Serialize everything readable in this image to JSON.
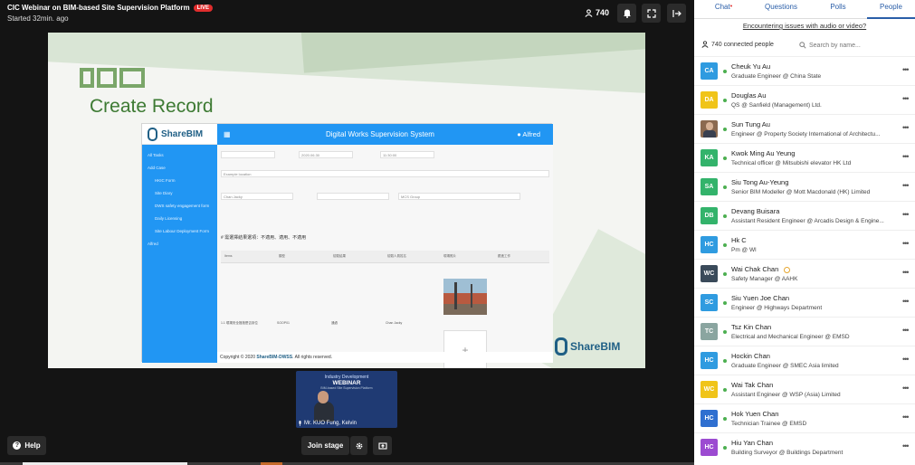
{
  "header": {
    "title": "CIC Webinar on BIM-based Site Supervision Platform",
    "live_label": "LIVE",
    "started": "Started 32min. ago",
    "viewer_count": "740"
  },
  "slide": {
    "title": "Create Record",
    "app": {
      "brand": "ShareBIM",
      "window_title": "Digital Works Supervision System",
      "user": "Alfred",
      "sidebar": [
        "All Tasks",
        "Add Case",
        "HKIC Form",
        "Site Diary",
        "DWS safety engagement form",
        "Daily Licensing",
        "Site Labour Deployment Form",
        "Alfred"
      ],
      "fields": {
        "date_value": "2020.06.30",
        "time_value": "11:30:00",
        "location_value": "Example location",
        "inspector_value": "Chan Jacky",
        "contractor_value": "MCS Group"
      },
      "note": "# 需選擇結果選項：不適用、適用、不適用",
      "grid_headers": [
        "Items",
        "類型",
        "檢驗結果",
        "檢驗人員姓名",
        "現場照片",
        "跟進工作"
      ],
      "cell_items": "1.1 現場安全措施是否到位",
      "cell_type": "SOOP01",
      "cell_result": "通過",
      "cell_person": "Chan Jacky",
      "add_symbol": "+",
      "footer_prefix": "Copyright © 2020 ",
      "footer_brand": "ShareBIM-DWSS",
      "footer_suffix": ". All rights reserved."
    },
    "brand_bottom": "ShareBIM"
  },
  "speaker": {
    "banner_top": "Industry Development",
    "banner_main": "WEBINAR",
    "banner_sub": "BIM-based Site Supervision Platform",
    "name": "Mr. KUO Fung, Kelvin"
  },
  "controls": {
    "help_label": "Help",
    "join_label": "Join stage"
  },
  "panel": {
    "tabs": [
      {
        "label": "Chat",
        "badge": "•"
      },
      {
        "label": "Questions"
      },
      {
        "label": "Polls"
      },
      {
        "label": "People"
      }
    ],
    "issue_link": "Encountering issues with audio or video?",
    "connected": "740 connected people",
    "search_placeholder": "Search by name...",
    "people": [
      {
        "initials": "CA",
        "color": "#2f9be0",
        "name": "Cheuk Yu Au",
        "role": "Graduate Engineer",
        "org": "China State"
      },
      {
        "initials": "DA",
        "color": "#f0c419",
        "name": "Douglas Au",
        "role": "QS",
        "org": "Sanfield (Management) Ltd."
      },
      {
        "initials": "",
        "color": "#8b6a50",
        "photo": true,
        "name": "Sun Tung Au",
        "role": "Engineer",
        "org": "Property Society International of Architectu..."
      },
      {
        "initials": "KA",
        "color": "#33b36b",
        "name": "Kwok Ming Au Yeung",
        "role": "Technical officer",
        "org": "Mitsubishi elevator HK Ltd"
      },
      {
        "initials": "SA",
        "color": "#33b36b",
        "name": "Siu Tong Au-Yeung",
        "role": "Senior BIM Modeller",
        "org": "Mott Macdonald (HK) Limited"
      },
      {
        "initials": "DB",
        "color": "#33b36b",
        "name": "Devang Buisara",
        "role": "Assistant Resident Engineer",
        "org": "Arcadis Design & Engine..."
      },
      {
        "initials": "HC",
        "color": "#2f9be0",
        "name": "Hk C",
        "role": "Pm",
        "org": "Wl"
      },
      {
        "initials": "WC",
        "color": "#3a4a5a",
        "name": "Wai Chak Chan",
        "role": "Safety Manager",
        "org": "AAHK",
        "hand": true
      },
      {
        "initials": "SC",
        "color": "#2f9be0",
        "name": "Siu Yuen Joe Chan",
        "role": "Engineer",
        "org": "Highways Department"
      },
      {
        "initials": "TC",
        "color": "#8aa5a0",
        "name": "Tsz Kin Chan",
        "role": "Electrical and Mechanical Engineer",
        "org": "EMSD"
      },
      {
        "initials": "HC",
        "color": "#2f9be0",
        "name": "Hockin Chan",
        "role": "Graduate Engineer",
        "org": "SMEC Asia limited"
      },
      {
        "initials": "WC",
        "color": "#f0c419",
        "name": "Wai Tak Chan",
        "role": "Assistant Engineer",
        "org": "WSP (Asia) Limited"
      },
      {
        "initials": "HC",
        "color": "#2f6fd0",
        "name": "Hok Yuen Chan",
        "role": "Technician Trainee",
        "org": "EMSD"
      },
      {
        "initials": "HC",
        "color": "#9c4bd1",
        "name": "Hiu Yan Chan",
        "role": "Building Surveyor",
        "org": "Buildings Department"
      }
    ]
  }
}
